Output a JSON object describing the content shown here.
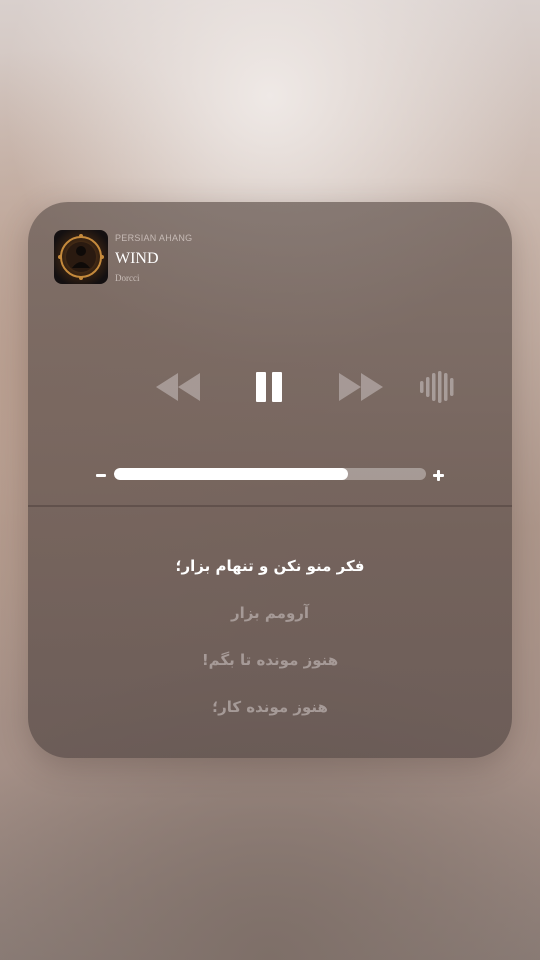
{
  "player": {
    "source": "PERSIAN AHANG",
    "track_title": "WIND",
    "artist": "Dorcci",
    "artwork_icon": "album-artwork",
    "playback_state": "playing",
    "volume_fraction": 0.75
  },
  "controls": {
    "rewind_icon": "rewind-icon",
    "pause_icon": "pause-icon",
    "forward_icon": "fast-forward-icon",
    "airplay_icon": "sound-waves-icon",
    "volume_minus": "−",
    "volume_plus": "+"
  },
  "lyrics": [
    {
      "text": "فکر منو نکن و تنهام بزار؛",
      "active": true
    },
    {
      "text": "آرومم بزار",
      "active": false
    },
    {
      "text": "هنوز مونده تا بگم!",
      "active": false
    },
    {
      "text": "هنوز مونده کار؛",
      "active": false
    }
  ],
  "colors": {
    "active_lyric": "#ffffff",
    "inactive_lyric": "#afa5a2",
    "volume_fill": "#ffffff"
  }
}
